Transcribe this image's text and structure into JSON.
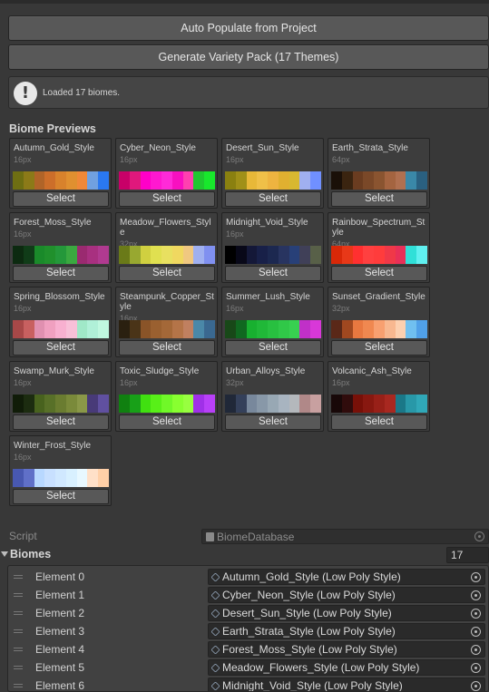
{
  "buttons": {
    "auto_populate": "Auto Populate from Project",
    "generate_pack": "Generate Variety Pack (17 Themes)"
  },
  "help": {
    "icon": "info-exclamation-icon",
    "text": "Loaded 17 biomes."
  },
  "previews_title": "Biome Previews",
  "select_label": "Select",
  "biomes": [
    {
      "name": "Autumn_Gold_Style",
      "size": "16px",
      "colors": [
        "#6e6e12",
        "#8c7a18",
        "#b06428",
        "#cc6e2a",
        "#d8822c",
        "#e09030",
        "#f08838",
        "#70a0e0",
        "#2a78f0"
      ]
    },
    {
      "name": "Cyber_Neon_Style",
      "size": "16px",
      "colors": [
        "#c80068",
        "#e0187c",
        "#ff00c8",
        "#ff18d0",
        "#ff2ad8",
        "#f810c0",
        "#ff40b0",
        "#20c830",
        "#18e82c"
      ]
    },
    {
      "name": "Desert_Sun_Style",
      "size": "16px",
      "colors": [
        "#8a8010",
        "#a09018",
        "#e8b838",
        "#f0c048",
        "#eeb440",
        "#e0b030",
        "#d8b830",
        "#a0b0f0",
        "#7090ff"
      ]
    },
    {
      "name": "Earth_Strata_Style",
      "size": "64px",
      "colors": [
        "#1a1008",
        "#3a2410",
        "#6a3c20",
        "#7a4828",
        "#8a5430",
        "#a46440",
        "#b07050",
        "#3a88a8",
        "#2a6080"
      ]
    },
    {
      "name": "Forest_Moss_Style",
      "size": "16px",
      "colors": [
        "#0c2a10",
        "#103c18",
        "#1a8a2a",
        "#20902c",
        "#24983a",
        "#3aa840",
        "#9a2a70",
        "#a83080",
        "#b03a90"
      ]
    },
    {
      "name": "Meadow_Flowers_Style",
      "size": "32px",
      "colors": [
        "#6a7a18",
        "#98a830",
        "#d0d040",
        "#e0e050",
        "#e8e060",
        "#f0d860",
        "#f0c880",
        "#a0b0f0",
        "#8090f0"
      ]
    },
    {
      "name": "Midnight_Void_Style",
      "size": "16px",
      "colors": [
        "#000000",
        "#080818",
        "#141838",
        "#182048",
        "#1c2850",
        "#283460",
        "#284078",
        "#404058",
        "#586048"
      ]
    },
    {
      "name": "Rainbow_Spectrum_Style",
      "size": "64px",
      "colors": [
        "#d82808",
        "#e83818",
        "#ff3030",
        "#ff4040",
        "#ff3c3c",
        "#f03848",
        "#e83058",
        "#30e0d8",
        "#60f0f0"
      ]
    },
    {
      "name": "Spring_Blossom_Style",
      "size": "16px",
      "colors": [
        "#a84848",
        "#c86060",
        "#e090b0",
        "#f0a0c0",
        "#f8b0d0",
        "#f8c0d8",
        "#a0e8c8",
        "#b0f0d8",
        "#c0f8e0"
      ]
    },
    {
      "name": "Steampunk_Copper_Style",
      "size": "16px",
      "colors": [
        "#2a2010",
        "#4a3418",
        "#8a5428",
        "#9a6030",
        "#a46838",
        "#b47448",
        "#c08060",
        "#4a88a8",
        "#3a6890"
      ]
    },
    {
      "name": "Summer_Lush_Style",
      "size": "16px",
      "colors": [
        "#184818",
        "#106820",
        "#18b030",
        "#20b838",
        "#28c040",
        "#30c848",
        "#38d050",
        "#c030c8",
        "#d838d8"
      ]
    },
    {
      "name": "Sunset_Gradient_Style",
      "size": "32px",
      "colors": [
        "#5a2818",
        "#a04820",
        "#e87840",
        "#f08850",
        "#f8a070",
        "#f8b890",
        "#fcd0b0",
        "#70c0f0",
        "#50a0e8"
      ]
    },
    {
      "name": "Swamp_Murk_Style",
      "size": "16px",
      "colors": [
        "#101c08",
        "#1c2c10",
        "#48621e",
        "#587028",
        "#6a7c30",
        "#7a8a3a",
        "#8a9848",
        "#483a78",
        "#6050a0"
      ]
    },
    {
      "name": "Toxic_Sludge_Style",
      "size": "16px",
      "colors": [
        "#108010",
        "#18a018",
        "#40e010",
        "#58f018",
        "#70f828",
        "#88ff30",
        "#98ff40",
        "#a030e8",
        "#b840f8"
      ]
    },
    {
      "name": "Urban_Alloys_Style",
      "size": "32px",
      "colors": [
        "#202838",
        "#34405a",
        "#78889c",
        "#8898a8",
        "#98a8b4",
        "#a8b4c0",
        "#b4b8bc",
        "#b08888",
        "#c8a0a0"
      ]
    },
    {
      "name": "Volcanic_Ash_Style",
      "size": "16px",
      "colors": [
        "#180808",
        "#300c0c",
        "#781008",
        "#881810",
        "#982018",
        "#a82820",
        "#1a7888",
        "#2898a8",
        "#30a8b8"
      ]
    },
    {
      "name": "Winter_Frost_Style",
      "size": "16px",
      "colors": [
        "#4858b0",
        "#6070c8",
        "#b8d8ff",
        "#c8e0ff",
        "#d0e8ff",
        "#d8f0ff",
        "#e8f8ff",
        "#ffe0c8",
        "#ffd0a8"
      ]
    }
  ],
  "script": {
    "label": "Script",
    "value": "BiomeDatabase"
  },
  "biomes_list": {
    "label": "Biomes",
    "size": "17",
    "elements": [
      {
        "label": "Element 0",
        "value": "Autumn_Gold_Style (Low Poly Style)"
      },
      {
        "label": "Element 1",
        "value": "Cyber_Neon_Style (Low Poly Style)"
      },
      {
        "label": "Element 2",
        "value": "Desert_Sun_Style (Low Poly Style)"
      },
      {
        "label": "Element 3",
        "value": "Earth_Strata_Style (Low Poly Style)"
      },
      {
        "label": "Element 4",
        "value": "Forest_Moss_Style (Low Poly Style)"
      },
      {
        "label": "Element 5",
        "value": "Meadow_Flowers_Style (Low Poly Style)"
      },
      {
        "label": "Element 6",
        "value": "Midnight_Void_Style (Low Poly Style)"
      }
    ]
  }
}
